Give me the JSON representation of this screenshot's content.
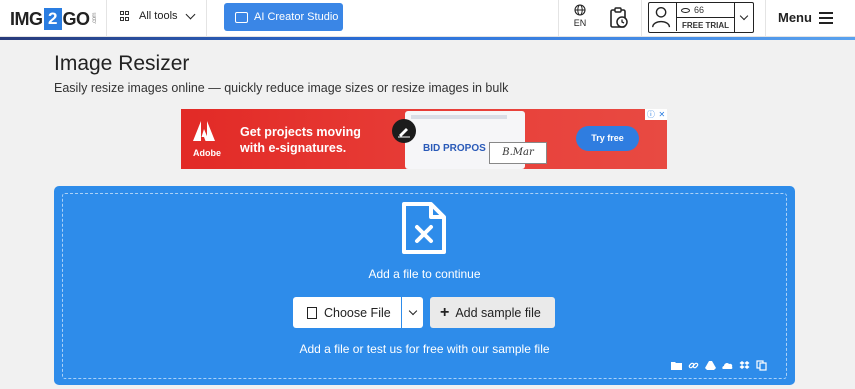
{
  "header": {
    "logo": {
      "pre": "IMG",
      "two": "2",
      "post": "GO",
      "suffix": ".com"
    },
    "all_tools_label": "All tools",
    "ai_button_label": "AI Creator Studio",
    "language": "EN",
    "account": {
      "credits": "66",
      "badge": "FREE TRIAL"
    },
    "menu_label": "Menu"
  },
  "page": {
    "title": "Image Resizer",
    "subtitle": "Easily resize images online — quickly reduce image sizes or resize images in bulk"
  },
  "ad": {
    "brand": "Adobe",
    "headline": "Get projects moving with e-signatures.",
    "screen_text": "BID PROPOS",
    "signature": "B.Mar",
    "cta": "Try free"
  },
  "upload": {
    "prompt": "Add a file to continue",
    "choose_file_label": "Choose File",
    "sample_label": "Add sample file",
    "hint": "Add a file or test us for free with our sample file"
  },
  "colors": {
    "accent": "#2e8cea",
    "button_blue": "#3a86e6",
    "ad_red": "#e22a26"
  }
}
